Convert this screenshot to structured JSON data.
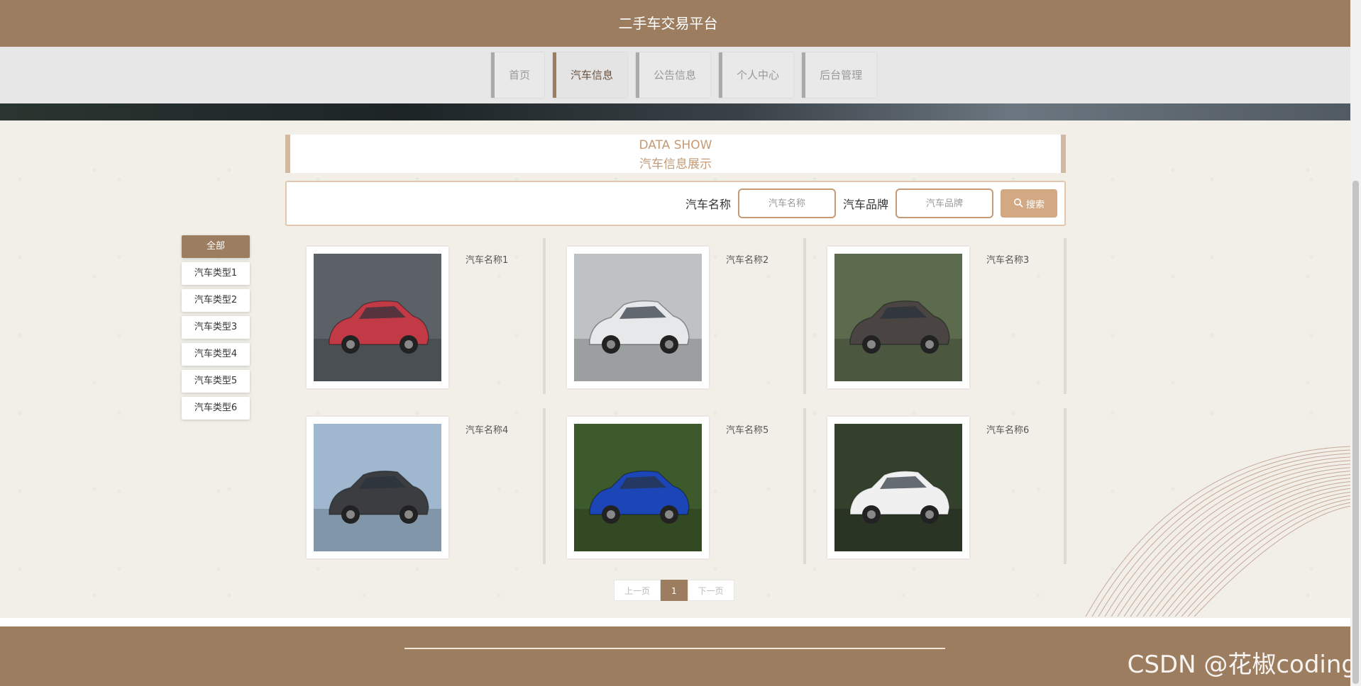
{
  "header": {
    "site_title": "二手车交易平台"
  },
  "nav": {
    "items": [
      {
        "label": "首页",
        "active": false
      },
      {
        "label": "汽车信息",
        "active": true
      },
      {
        "label": "公告信息",
        "active": false
      },
      {
        "label": "个人中心",
        "active": false
      },
      {
        "label": "后台管理",
        "active": false
      }
    ]
  },
  "section": {
    "title_en": "DATA SHOW",
    "title_cn": "汽车信息展示"
  },
  "search": {
    "name_label": "汽车名称",
    "name_placeholder": "汽车名称",
    "brand_label": "汽车品牌",
    "brand_placeholder": "汽车品牌",
    "button_label": "搜索",
    "button_icon": "search-icon"
  },
  "categories": [
    {
      "label": "全部",
      "active": true
    },
    {
      "label": "汽车类型1",
      "active": false
    },
    {
      "label": "汽车类型2",
      "active": false
    },
    {
      "label": "汽车类型3",
      "active": false
    },
    {
      "label": "汽车类型4",
      "active": false
    },
    {
      "label": "汽车类型5",
      "active": false
    },
    {
      "label": "汽车类型6",
      "active": false
    }
  ],
  "cars": [
    {
      "name": "汽车名称1",
      "color": "#c23a45",
      "bg": "#5b6166"
    },
    {
      "name": "汽车名称2",
      "color": "#e6e8ea",
      "bg": "#bfc2c4"
    },
    {
      "name": "汽车名称3",
      "color": "#4a4543",
      "bg": "#5c6b4e"
    },
    {
      "name": "汽车名称4",
      "color": "#3c3d40",
      "bg": "#9fb8cf"
    },
    {
      "name": "汽车名称5",
      "color": "#1c46b8",
      "bg": "#3d5a2c"
    },
    {
      "name": "汽车名称6",
      "color": "#f0f0f0",
      "bg": "#33402c"
    }
  ],
  "pager": {
    "prev": "上一页",
    "current": "1",
    "next": "下一页"
  },
  "watermark": "CSDN @花椒coding",
  "colors": {
    "brand": "#9d7d5f",
    "accent": "#d3a983",
    "section_text": "#c49a77"
  }
}
